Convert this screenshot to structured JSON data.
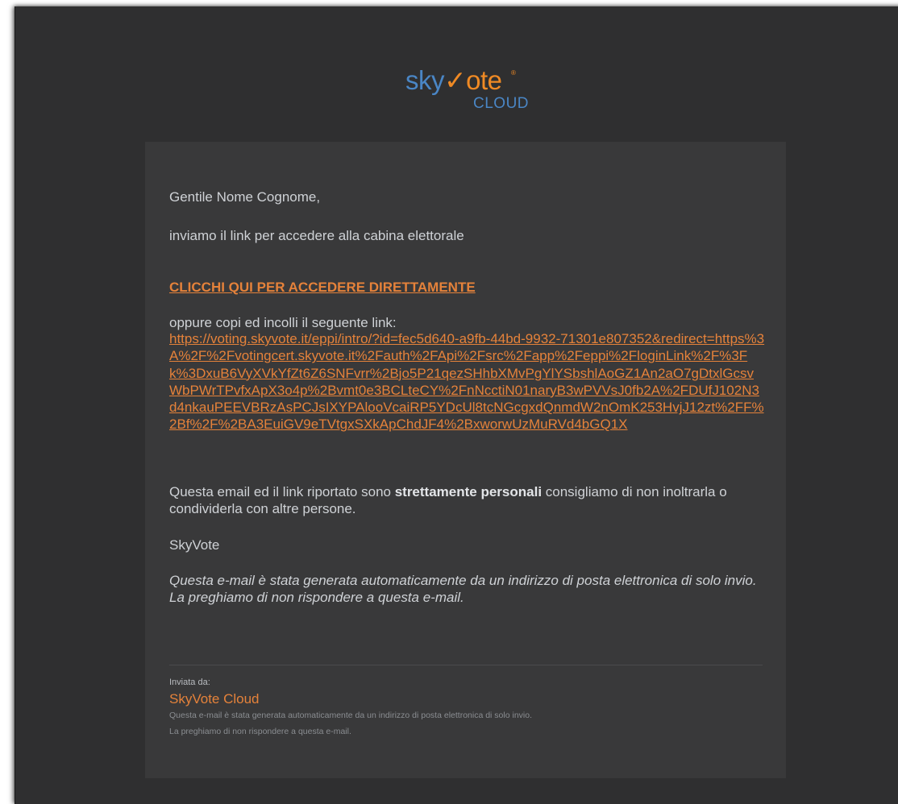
{
  "logo": {
    "sky": "sky",
    "check": "✓",
    "vote": "ote",
    "reg": "®",
    "cloud": "CLOUD"
  },
  "email": {
    "greeting": "Gentile Nome Cognome,",
    "intro": "inviamo il link per accedere alla cabina elettorale",
    "cta_label": "CLICCHI QUI PER ACCEDERE DIRETTAMENTE",
    "copy_label": "oppure copi ed incolli il seguente link:",
    "long_link": "https://voting.skyvote.it/eppi/intro/?id=fec5d640-a9fb-44bd-9932-71301e807352&redirect=https%3A%2F%2Fvotingcert.skyvote.it%2Fauth%2FApi%2Fsrc%2Fapp%2Feppi%2FloginLink%2F%3Fk%3DxuB6VyXVkYfZt6Z6SNFvrr%2Bjo5P21qezSHhbXMvPgYlYSbshlAoGZ1An2aO7gDtxlGcsvWbPWrTPvfxApX3o4p%2Bvmt0e3BCLteCY%2FnNcctiN01naryB3wPVVsJ0fb2A%2FDUfJ102N3d4nkauPEEVBRzAsPCJsIXYPAlooVcaiRP5YDcUl8tcNGcgxdQnmdW2nOmK253HvjJ12zt%2FF%2Bf%2F%2BA3EuiGV9eTVtgxSXkApChdJF4%2BxworwUzMuRVd4bGQ1X",
    "personal_before": "Questa email ed il link riportato sono ",
    "personal_bold": "strettamente personali",
    "personal_after": " consigliamo di non inoltrarla o condividerla con altre persone.",
    "signature": "SkyVote",
    "auto_line1": "Questa e-mail è stata generata automaticamente da un indirizzo di posta elettronica di solo invio.",
    "auto_line2": "La preghiamo di non rispondere a questa e-mail."
  },
  "footer": {
    "sent_by_label": "Inviata da:",
    "brand": "SkyVote Cloud",
    "note_line1": "Questa e-mail è stata generata automaticamente da un indirizzo di posta elettronica di solo invio.",
    "note_line2": "La preghiamo di non rispondere a questa e-mail."
  },
  "colors": {
    "window_bg": "#2f2f30",
    "card_bg": "#39393a",
    "link_orange": "#e5823a",
    "logo_blue": "#4a86c5",
    "logo_orange": "#f08a24"
  }
}
